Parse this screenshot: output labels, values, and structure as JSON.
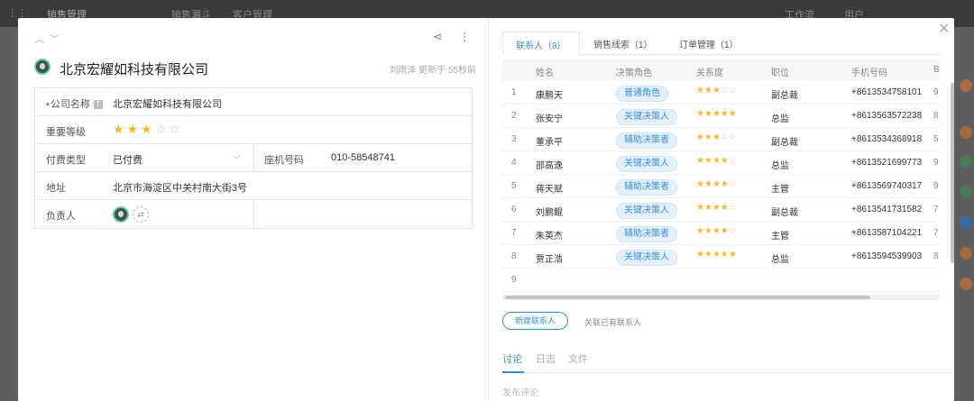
{
  "background": {
    "app_title": "销售管理",
    "nav_items": [
      "销售漏斗",
      "客户管理"
    ],
    "right_items": [
      "工作流",
      "用户"
    ]
  },
  "left": {
    "company_title": "北京宏耀如科技有限公司",
    "updated_text": "刘雨泽 更新于 55秒前",
    "fields": {
      "company_name_label": "公司名称",
      "company_name_value": "北京宏耀如科技有限公司",
      "importance_label": "重要等级",
      "importance_rating": 3,
      "importance_max": 5,
      "payment_label": "付费类型",
      "payment_value": "已付费",
      "phone_label": "座机号码",
      "phone_value": "010-58548741",
      "address_label": "地址",
      "address_value": "北京市海淀区中关村南大街3号",
      "owner_label": "负责人"
    }
  },
  "right": {
    "tabs": [
      {
        "label": "联系人（8）",
        "active": true
      },
      {
        "label": "销售线索（1）",
        "active": false
      },
      {
        "label": "订单管理（1）",
        "active": false
      }
    ],
    "columns": [
      "姓名",
      "决策角色",
      "关系度",
      "职位",
      "手机号码",
      "B"
    ],
    "rows": [
      {
        "idx": "1",
        "name": "康鹏天",
        "role": "普通角色",
        "rel": 3,
        "pos": "副总裁",
        "phone": "+8613534758101",
        "more": "9"
      },
      {
        "idx": "2",
        "name": "张安宁",
        "role": "关键决策人",
        "rel": 5,
        "pos": "总监",
        "phone": "+8613563572238",
        "more": "8"
      },
      {
        "idx": "3",
        "name": "董承平",
        "role": "辅助决策者",
        "rel": 3,
        "pos": "副总裁",
        "phone": "+8613534368918",
        "more": "5"
      },
      {
        "idx": "4",
        "name": "邵高逸",
        "role": "关键决策人",
        "rel": 4,
        "pos": "总监",
        "phone": "+8613521699773",
        "more": "9"
      },
      {
        "idx": "5",
        "name": "蒋天赋",
        "role": "辅助决策者",
        "rel": 4,
        "pos": "主管",
        "phone": "+8613569740317",
        "more": "9"
      },
      {
        "idx": "6",
        "name": "刘鹏鲲",
        "role": "关键决策人",
        "rel": 4,
        "pos": "副总裁",
        "phone": "+8613541731582",
        "more": "7"
      },
      {
        "idx": "7",
        "name": "朱英杰",
        "role": "辅助决策者",
        "rel": 4,
        "pos": "主管",
        "phone": "+8613587104221",
        "more": "7"
      },
      {
        "idx": "8",
        "name": "贾正浩",
        "role": "关键决策人",
        "rel": 5,
        "pos": "总监",
        "phone": "+8613594539903",
        "more": "8"
      },
      {
        "idx": "9",
        "name": "",
        "role": "",
        "rel": 0,
        "pos": "",
        "phone": "",
        "more": ""
      }
    ],
    "new_contact_button": "新建联系人",
    "associate_link": "关联已有联系人",
    "subtabs": [
      "讨论",
      "日志",
      "文件"
    ],
    "comment_placeholder": "发布评论"
  },
  "colors": {
    "accent": "#3b8ed8",
    "star": "#f5b82e",
    "tag_bg": "#e4f1fc"
  }
}
